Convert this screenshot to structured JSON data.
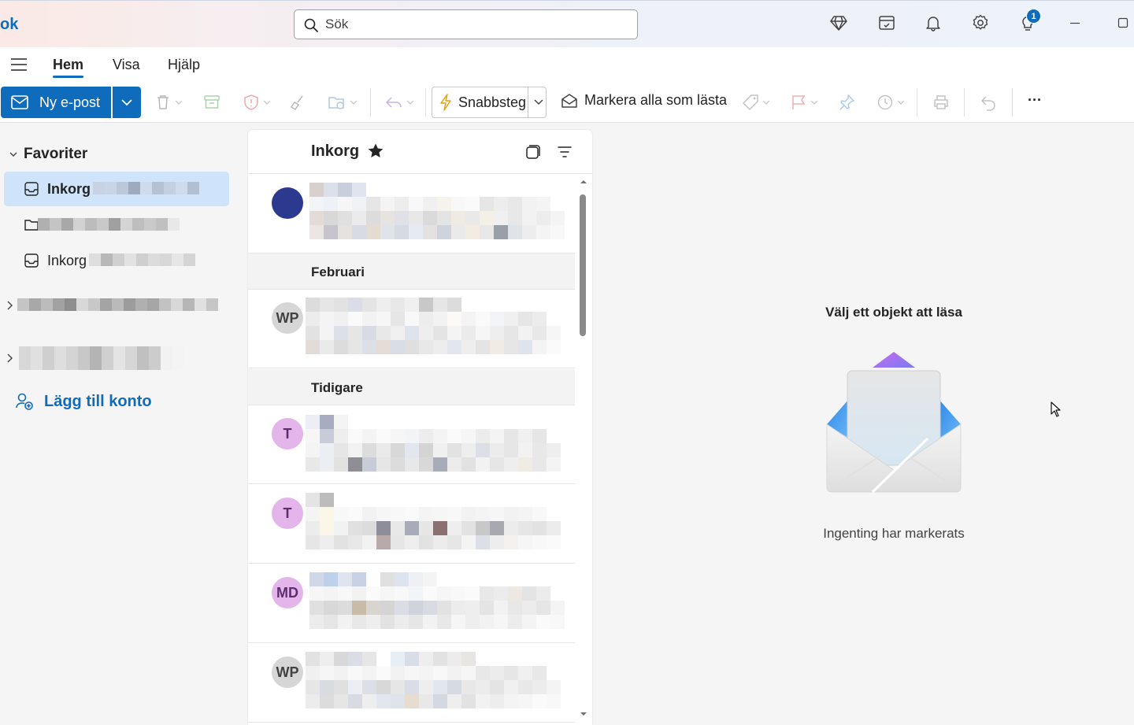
{
  "app": {
    "title": "ok"
  },
  "search": {
    "placeholder": "Sök"
  },
  "titlebar": {
    "notification_count": "1"
  },
  "tabs": [
    {
      "label": "Hem"
    },
    {
      "label": "Visa"
    },
    {
      "label": "Hjälp"
    }
  ],
  "toolbar": {
    "new_mail_label": "Ny e-post",
    "quick_steps_label": "Snabbsteg",
    "mark_all_read_label": "Markera alla som lästa",
    "more_label": "···"
  },
  "nav": {
    "favorites_label": "Favoriter",
    "items": [
      {
        "label": "Inkorg"
      },
      {
        "label": ""
      },
      {
        "label": "Inkorg"
      }
    ],
    "add_account_label": "Lägg till konto"
  },
  "list": {
    "title": "Inkorg",
    "groups": [
      {
        "label": "Februari"
      },
      {
        "label": "Tidigare"
      }
    ],
    "messages": [
      {
        "initials": "",
        "avatar_color": "#2b3a8f"
      },
      {
        "initials": "WP",
        "avatar_color": "#d6d6d6"
      },
      {
        "initials": "T",
        "avatar_color": "#e3b5ea"
      },
      {
        "initials": "T",
        "avatar_color": "#e3b5ea"
      },
      {
        "initials": "MD",
        "avatar_color": "#e3b5ea"
      },
      {
        "initials": "WP",
        "avatar_color": "#d6d6d6"
      }
    ]
  },
  "reading": {
    "title": "Välj ett objekt att läsa",
    "subtitle": "Ingenting har markerats"
  },
  "colors": {
    "accent": "#0f6cbd",
    "selected": "#cfe4fa"
  }
}
